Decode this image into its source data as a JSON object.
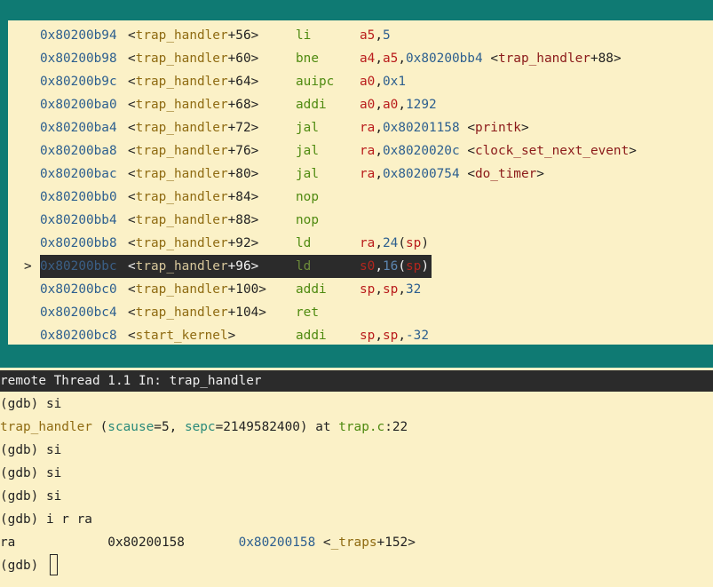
{
  "asm": {
    "rows": [
      {
        "addr": "0x80200b94",
        "fname": "trap_handler",
        "off": "+56",
        "mnem": "li",
        "ops": "a5,5"
      },
      {
        "addr": "0x80200b98",
        "fname": "trap_handler",
        "off": "+60",
        "mnem": "bne",
        "ops": "a4,a5,0x80200bb4 <trap_handler+88>"
      },
      {
        "addr": "0x80200b9c",
        "fname": "trap_handler",
        "off": "+64",
        "mnem": "auipc",
        "ops": "a0,0x1"
      },
      {
        "addr": "0x80200ba0",
        "fname": "trap_handler",
        "off": "+68",
        "mnem": "addi",
        "ops": "a0,a0,1292"
      },
      {
        "addr": "0x80200ba4",
        "fname": "trap_handler",
        "off": "+72",
        "mnem": "jal",
        "ops": "ra,0x80201158 <printk>"
      },
      {
        "addr": "0x80200ba8",
        "fname": "trap_handler",
        "off": "+76",
        "mnem": "jal",
        "ops": "ra,0x8020020c <clock_set_next_event>"
      },
      {
        "addr": "0x80200bac",
        "fname": "trap_handler",
        "off": "+80",
        "mnem": "jal",
        "ops": "ra,0x80200754 <do_timer>"
      },
      {
        "addr": "0x80200bb0",
        "fname": "trap_handler",
        "off": "+84",
        "mnem": "nop",
        "ops": ""
      },
      {
        "addr": "0x80200bb4",
        "fname": "trap_handler",
        "off": "+88",
        "mnem": "nop",
        "ops": ""
      },
      {
        "addr": "0x80200bb8",
        "fname": "trap_handler",
        "off": "+92",
        "mnem": "ld",
        "ops": "ra,24(sp)"
      },
      {
        "addr": "0x80200bbc",
        "fname": "trap_handler",
        "off": "+96",
        "mnem": "ld",
        "ops": "s0,16(sp)",
        "marker": ">"
      },
      {
        "addr": "0x80200bc0",
        "fname": "trap_handler",
        "off": "+100",
        "mnem": "addi",
        "ops": "sp,sp,32"
      },
      {
        "addr": "0x80200bc4",
        "fname": "trap_handler",
        "off": "+104",
        "mnem": "ret",
        "ops": ""
      },
      {
        "addr": "0x80200bc8",
        "fname": "start_kernel",
        "off": "",
        "mnem": "addi",
        "ops": "sp,sp,-32"
      }
    ]
  },
  "status": {
    "text": "remote Thread 1.1 In: trap_handler"
  },
  "console": {
    "lines": [
      {
        "text": "(gdb) si"
      },
      {
        "parts": [
          [
            "trap_handler",
            "c-yellow"
          ],
          [
            " (",
            ""
          ],
          [
            "scause",
            "c-teal"
          ],
          [
            "=5, ",
            ""
          ],
          [
            "sepc",
            "c-teal"
          ],
          [
            "=2149582400) at ",
            ""
          ],
          [
            "trap.c",
            "c-green"
          ],
          [
            ":22",
            ""
          ]
        ]
      },
      {
        "text": "(gdb) si"
      },
      {
        "text": "(gdb) si"
      },
      {
        "text": "(gdb) si"
      },
      {
        "text": "(gdb) i r ra"
      },
      {
        "parts": [
          [
            "ra            ",
            ""
          ],
          [
            "0x80200158",
            ""
          ],
          [
            "       ",
            ""
          ],
          [
            "0x80200158",
            "c-blue"
          ],
          [
            " <",
            ""
          ],
          [
            "_traps",
            "c-yellow"
          ],
          [
            "+152>",
            ""
          ]
        ]
      }
    ],
    "prompt": "(gdb) "
  }
}
